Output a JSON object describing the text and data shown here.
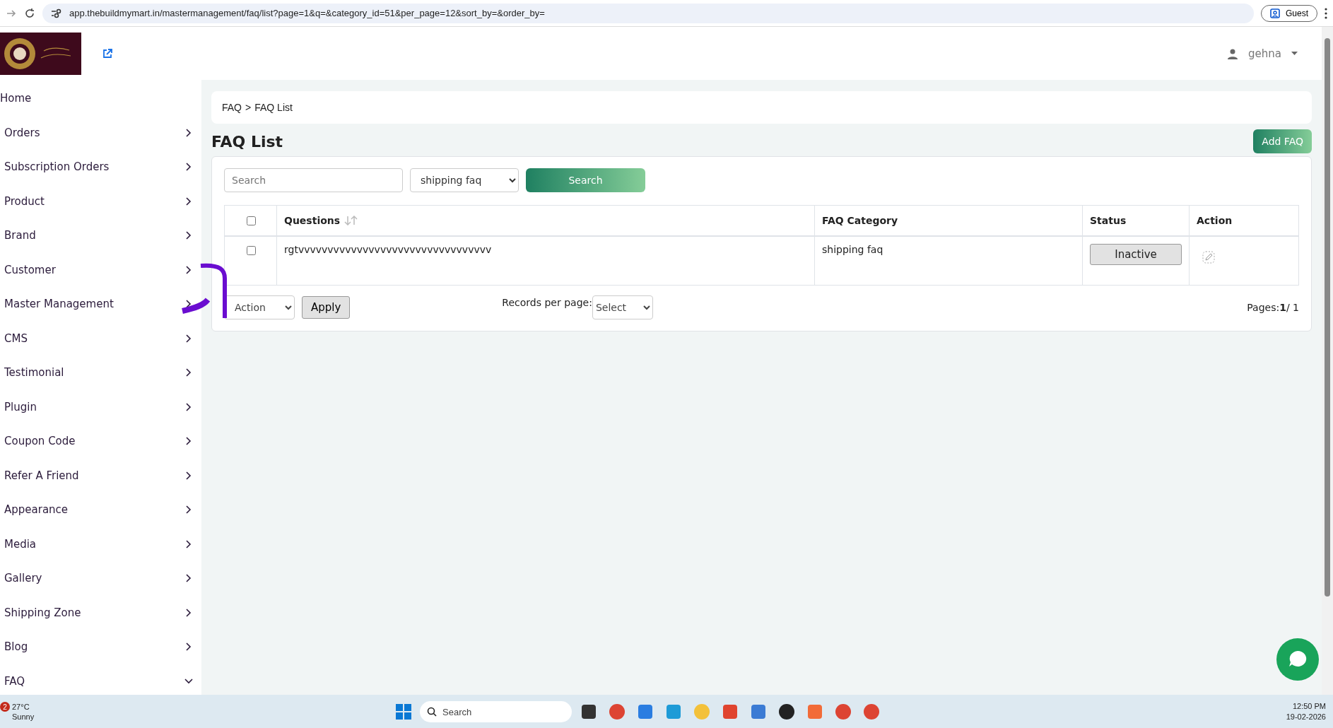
{
  "browser": {
    "url": "app.thebuildmymart.in/mastermanagement/faq/list?page=1&q=&category_id=51&per_page=12&sort_by=&order_by=",
    "profile": "Guest"
  },
  "header": {
    "user": "gehna"
  },
  "sidebar": {
    "items": [
      {
        "label": "Home",
        "kind": "link"
      },
      {
        "label": "Orders",
        "kind": "menu",
        "expanded": false
      },
      {
        "label": "Subscription Orders",
        "kind": "menu",
        "expanded": false
      },
      {
        "label": "Product",
        "kind": "menu",
        "expanded": false
      },
      {
        "label": "Brand",
        "kind": "menu",
        "expanded": false
      },
      {
        "label": "Customer",
        "kind": "menu",
        "expanded": false
      },
      {
        "label": "Master Management",
        "kind": "menu",
        "expanded": false
      },
      {
        "label": "CMS",
        "kind": "menu",
        "expanded": false
      },
      {
        "label": "Testimonial",
        "kind": "menu",
        "expanded": false
      },
      {
        "label": "Plugin",
        "kind": "menu",
        "expanded": false
      },
      {
        "label": "Coupon Code",
        "kind": "menu",
        "expanded": false
      },
      {
        "label": "Refer A Friend",
        "kind": "menu",
        "expanded": false
      },
      {
        "label": "Appearance",
        "kind": "menu",
        "expanded": false
      },
      {
        "label": "Media",
        "kind": "menu",
        "expanded": false
      },
      {
        "label": "Gallery",
        "kind": "menu",
        "expanded": false
      },
      {
        "label": "Shipping Zone",
        "kind": "menu",
        "expanded": false
      },
      {
        "label": "Blog",
        "kind": "menu",
        "expanded": false
      },
      {
        "label": "FAQ",
        "kind": "menu",
        "expanded": true
      }
    ]
  },
  "breadcrumb": {
    "items": [
      "FAQ",
      "FAQ List"
    ],
    "separator": ">"
  },
  "page_title": "FAQ List",
  "add_button": "Add FAQ",
  "filters": {
    "search_placeholder": "Search",
    "category": "shipping faq",
    "search_button": "Search"
  },
  "table": {
    "select_all_checked": false,
    "columns": [
      {
        "label": "Questions",
        "sortable": true
      },
      {
        "label": "FAQ Category",
        "sortable": false
      },
      {
        "label": "Status",
        "sortable": false
      },
      {
        "label": "Action",
        "sortable": false
      }
    ],
    "rows": [
      {
        "checked": false,
        "question": "rgtvvvvvvvvvvvvvvvvvvvvvvvvvvvvvvvvv",
        "category": "shipping faq",
        "status": "Inactive"
      }
    ]
  },
  "footer": {
    "action": "Action",
    "apply": "Apply",
    "records_label": "Records per page:",
    "records_select": "Select",
    "pages": "Pages:**1**/ 1"
  },
  "taskbar": {
    "badge": "2",
    "temperature": "27°C",
    "weather": "Sunny",
    "search_placeholder": "Search",
    "time": "12:50 PM",
    "date": "19-02-2026"
  }
}
